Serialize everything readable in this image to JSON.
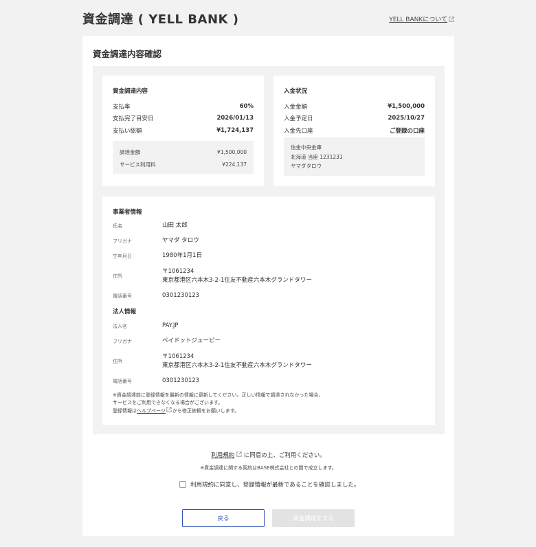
{
  "header": {
    "title": "資金調達 ( YELL BANK )",
    "about_link": "YELL BANKについて"
  },
  "card_title": "資金調達内容確認",
  "funding": {
    "title": "資金調達内容",
    "rows": [
      {
        "label": "支払率",
        "value": "60%"
      },
      {
        "label": "支払完了目安日",
        "value": "2026/01/13"
      },
      {
        "label": "支払い総額",
        "value": "¥1,724,137"
      }
    ],
    "breakdown": [
      {
        "label": "調達金額",
        "value": "¥1,500,000"
      },
      {
        "label": "サービス利用料",
        "value": "¥224,137"
      }
    ]
  },
  "deposit": {
    "title": "入金状況",
    "rows": [
      {
        "label": "入金金額",
        "value": "¥1,500,000"
      },
      {
        "label": "入金予定日",
        "value": "2025/10/27"
      },
      {
        "label": "入金先口座",
        "value": "ご登録の口座"
      }
    ],
    "bank": {
      "name": "信金中央金庫",
      "branch": "北海道 当座 1231231",
      "holder": "ヤマダタロウ"
    }
  },
  "business": {
    "title": "事業者情報",
    "name_label": "氏名",
    "name": "山田 太郎",
    "kana_label": "フリガナ",
    "kana": "ヤマダ タロウ",
    "birth_label": "生年月日",
    "birth": "1980年1月1日",
    "address_label": "住所",
    "postal": "〒1061234",
    "address": "東京都港区六本木3-2-1住友不動産六本木グランドタワー",
    "phone_label": "電話番号",
    "phone": "0301230123"
  },
  "corporate": {
    "title": "法人情報",
    "name_label": "法人名",
    "name": "PAY.JP",
    "kana_label": "フリガナ",
    "kana": "ペイドットジェーピー",
    "address_label": "住所",
    "postal": "〒1061234",
    "address": "東京都港区六本木3-2-1住友不動産六本木グランドタワー",
    "phone_label": "電話番号",
    "phone": "0301230123"
  },
  "notes": {
    "line1": "※資金調達前に登録情報を最新の情報に更新してください。正しい情報で調達されなかった場合、",
    "line2": "サービスをご利用できなくなる場合がございます。",
    "line3_pre": "登録情報は",
    "help_link": "ヘルプページ",
    "line3_post": "から修正依頼をお願いします。"
  },
  "terms": {
    "link": "利用規約",
    "text": "に同意の上、ご利用ください。",
    "note": "※資金調達に関する契約はBASE株式会社との間で成立します。",
    "agree": "利用規約に同意し、登録情報が最新であることを確認しました。"
  },
  "buttons": {
    "back": "戻る",
    "submit": "資金調達をする"
  },
  "colors": {
    "accent": "#2f55b5",
    "disabled": "#e3e3e3",
    "background": "#f2f2f2"
  }
}
